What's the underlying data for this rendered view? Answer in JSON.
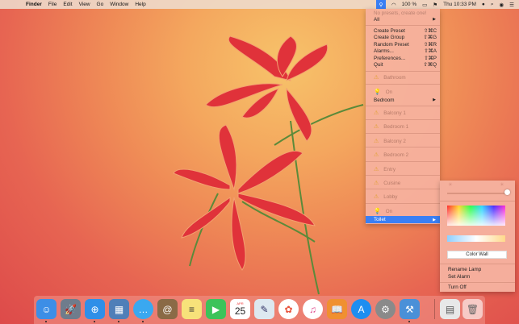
{
  "menubar": {
    "apple_icon": "apple-icon",
    "items": [
      "Finder",
      "File",
      "Edit",
      "View",
      "Go",
      "Window",
      "Help"
    ],
    "battery": "100 %",
    "clock": "Thu 10:33 PM"
  },
  "menu": {
    "presets_hint": "No presets, create one!",
    "all_label": "All",
    "actions": [
      {
        "label": "Create Preset",
        "shortcut": "⇧⌘C"
      },
      {
        "label": "Create Group",
        "shortcut": "⇧⌘G"
      },
      {
        "label": "Random Preset",
        "shortcut": "⇧⌘R"
      },
      {
        "label": "Alarms...",
        "shortcut": "⇧⌘A"
      },
      {
        "label": "Preferences...",
        "shortcut": "⇧⌘P"
      },
      {
        "label": "Quit",
        "shortcut": "⇧⌘Q"
      }
    ],
    "bathroom": "Bathroom",
    "on1": "On",
    "bedroom": "Bedroom",
    "balcony1": "Balcony 1",
    "bedroom1": "Bedroom 1",
    "balcony2": "Balcony 2",
    "bedroom2": "Bedroom 2",
    "entry": "Entry",
    "cuisine": "Cuisine",
    "lobby": "Lobby",
    "on2": "On",
    "toilet": "Toilet"
  },
  "panel": {
    "color_wall": "Color Wall",
    "rename_lamp": "Rename Lamp",
    "set_alarm": "Set Alarm",
    "turn_off": "Turn Off"
  },
  "dock": {
    "apps": [
      "Finder",
      "Launchpad",
      "Safari",
      "Photo Slideshow",
      "Messages",
      "Contacts",
      "Notes",
      "FaceTime",
      "Calendar",
      "Preview",
      "Photos",
      "iTunes",
      "iBooks",
      "App Store",
      "System Preferences",
      "Xcode",
      "Documents",
      "Trash"
    ],
    "calendar_month": "APR",
    "calendar_day": "25"
  },
  "colors": {
    "accent": "#3a7ff4",
    "warning": "#e0a030"
  }
}
